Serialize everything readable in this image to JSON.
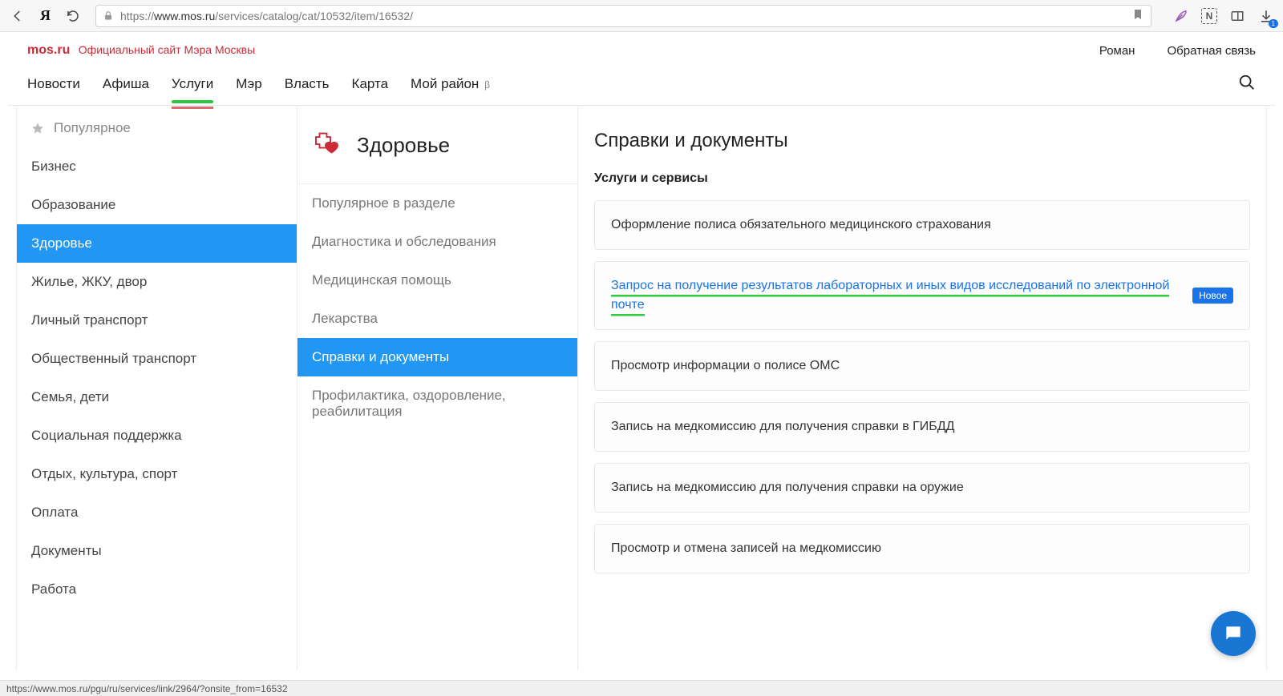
{
  "browser": {
    "url_prefix": "https://",
    "url_host": "www.mos.ru",
    "url_path": "/services/catalog/cat/10532/item/16532/",
    "status_url": "https://www.mos.ru/pgu/ru/services/link/2964/?onsite_from=16532",
    "download_badge": "1"
  },
  "header": {
    "logo_main": "mos.ru",
    "logo_sub": "Официальный сайт Мэра Москвы",
    "user_name": "Роман",
    "feedback": "Обратная связь"
  },
  "nav": {
    "items": [
      {
        "label": "Новости"
      },
      {
        "label": "Афиша"
      },
      {
        "label": "Услуги"
      },
      {
        "label": "Мэр"
      },
      {
        "label": "Власть"
      },
      {
        "label": "Карта"
      },
      {
        "label": "Мой район"
      }
    ],
    "beta": "β"
  },
  "sidebar": {
    "items": [
      "Популярное",
      "Бизнес",
      "Образование",
      "Здоровье",
      "Жилье, ЖКУ, двор",
      "Личный транспорт",
      "Общественный транспорт",
      "Семья, дети",
      "Социальная поддержка",
      "Отдых, культура, спорт",
      "Оплата",
      "Документы",
      "Работа"
    ]
  },
  "subnav": {
    "title": "Здоровье",
    "items": [
      "Популярное в разделе",
      "Диагностика и обследования",
      "Медицинская помощь",
      "Лекарства",
      "Справки и документы",
      "Профилактика, оздоровление, реабилитация"
    ]
  },
  "main": {
    "title": "Справки и документы",
    "subtitle": "Услуги и сервисы",
    "new_label": "Новое",
    "services": [
      {
        "text": "Оформление полиса обязательного медицинского страхования"
      },
      {
        "text": "Запрос на получение результатов лабораторных и иных видов исследований по электронной почте",
        "highlight": true,
        "is_new": true
      },
      {
        "text": "Просмотр информации о полисе ОМС"
      },
      {
        "text": "Запись на медкомиссию для получения справки в ГИБДД"
      },
      {
        "text": "Запись на медкомиссию для получения справки на оружие"
      },
      {
        "text": "Просмотр и отмена записей на медкомиссию"
      }
    ]
  }
}
